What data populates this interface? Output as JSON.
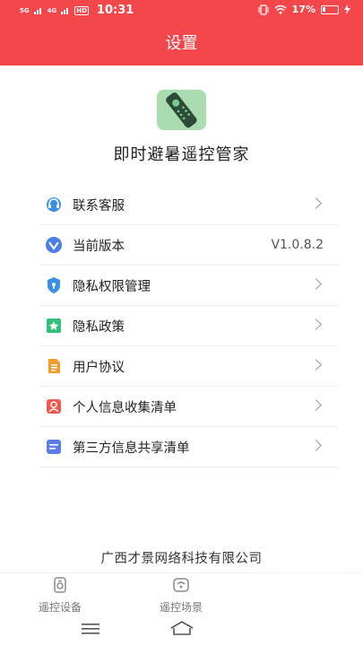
{
  "status": {
    "signal1": "5G",
    "signal2": "4G",
    "hd": "HD",
    "time": "10:31",
    "battery": "17%"
  },
  "header": {
    "title": "设置"
  },
  "app": {
    "name": "即时避暑遥控管家"
  },
  "menu": [
    {
      "label": "联系客服",
      "icon": "headset-icon",
      "color": "#3b8fea"
    },
    {
      "label": "当前版本",
      "icon": "version-icon",
      "color": "#4a7ee6",
      "value": "V1.0.8.2"
    },
    {
      "label": "隐私权限管理",
      "icon": "shield-icon",
      "color": "#3b8fea"
    },
    {
      "label": "隐私政策",
      "icon": "policy-icon",
      "color": "#33c27a"
    },
    {
      "label": "用户协议",
      "icon": "document-icon",
      "color": "#f39c2b"
    },
    {
      "label": "个人信息收集清单",
      "icon": "person-list-icon",
      "color": "#f0584e"
    },
    {
      "label": "第三方信息共享清单",
      "icon": "share-list-icon",
      "color": "#5b7de8"
    }
  ],
  "footer": {
    "company": "广西才景网络科技有限公司"
  },
  "tabs": [
    {
      "label": "遥控设备"
    },
    {
      "label": "遥控场景"
    }
  ]
}
